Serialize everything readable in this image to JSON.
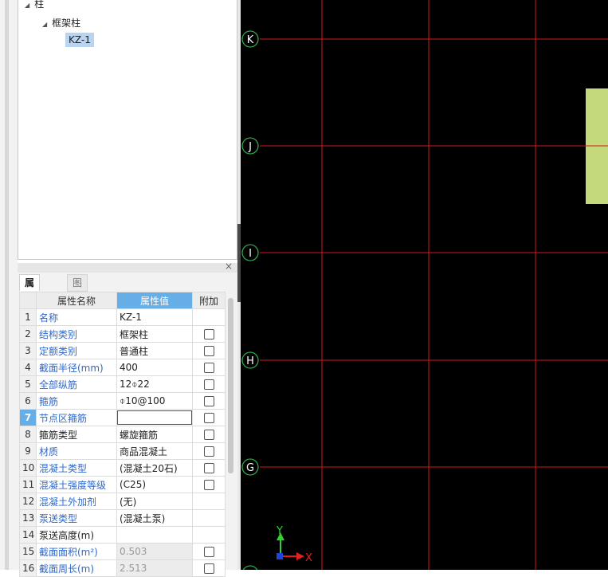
{
  "tree": {
    "root": {
      "label": "柱",
      "expanded": true
    },
    "group": {
      "label": "框架柱",
      "expanded": true
    },
    "selected_item": {
      "label": "KZ-1"
    }
  },
  "property_panel": {
    "tabs": [
      {
        "label": "属性列表",
        "active": true
      },
      {
        "label": "图层管理",
        "active": false
      }
    ],
    "columns": {
      "num": "",
      "name": "属性名称",
      "value": "属性值",
      "add": "附加"
    },
    "rows": [
      {
        "num": "1",
        "name": "名称",
        "value": "KZ-1",
        "blue": true,
        "checkbox": false
      },
      {
        "num": "2",
        "name": "结构类别",
        "value": "框架柱",
        "blue": true,
        "checkbox": true
      },
      {
        "num": "3",
        "name": "定额类别",
        "value": "普通柱",
        "blue": true,
        "checkbox": true
      },
      {
        "num": "4",
        "name": "截面半径(mm)",
        "value": "400",
        "blue": true,
        "checkbox": true
      },
      {
        "num": "5",
        "name": "全部纵筋",
        "value": "12⌽22",
        "blue": true,
        "checkbox": true
      },
      {
        "num": "6",
        "name": "箍筋",
        "value": "⌽10@100",
        "blue": true,
        "checkbox": true
      },
      {
        "num": "7",
        "name": "节点区箍筋",
        "value": "",
        "blue": true,
        "checkbox": true,
        "current": true,
        "editing": true
      },
      {
        "num": "8",
        "name": "箍筋类型",
        "value": "螺旋箍筋",
        "blue": false,
        "checkbox": true
      },
      {
        "num": "9",
        "name": "材质",
        "value": "商品混凝土",
        "blue": true,
        "checkbox": true
      },
      {
        "num": "10",
        "name": "混凝土类型",
        "value": "(混凝土20石)",
        "blue": true,
        "checkbox": true
      },
      {
        "num": "11",
        "name": "混凝土强度等级",
        "value": "(C25)",
        "blue": true,
        "checkbox": true
      },
      {
        "num": "12",
        "name": "混凝土外加剂",
        "value": "(无)",
        "blue": true,
        "checkbox": false
      },
      {
        "num": "13",
        "name": "泵送类型",
        "value": "(混凝土泵)",
        "blue": true,
        "checkbox": false
      },
      {
        "num": "14",
        "name": "泵送高度(m)",
        "value": "",
        "blue": false,
        "checkbox": false
      },
      {
        "num": "15",
        "name": "截面面积(m²)",
        "value": "0.503",
        "blue": true,
        "checkbox": true,
        "readonly": true
      },
      {
        "num": "16",
        "name": "截面周长(m)",
        "value": "2.513",
        "blue": true,
        "checkbox": true,
        "readonly": true
      }
    ]
  },
  "canvas": {
    "background": "#000000",
    "grid_color": "#d11a1a",
    "axis_labels": [
      "K",
      "J",
      "I",
      "H",
      "G"
    ],
    "ucs": {
      "y": "Y",
      "x": "X"
    },
    "column_fill": "#c4d97c"
  }
}
